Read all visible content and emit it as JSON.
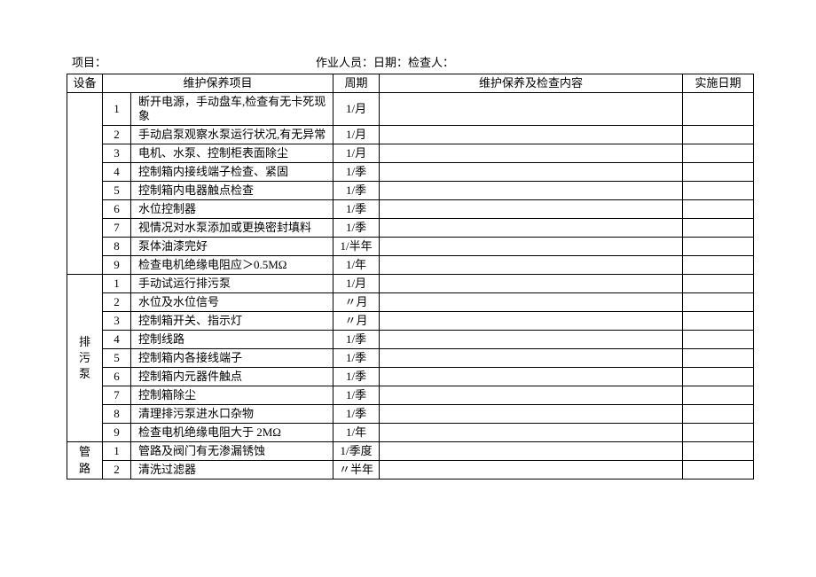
{
  "form_header": {
    "project": "项目：",
    "operator": "作业人员：",
    "date": "日期：",
    "inspector": "检查人："
  },
  "headers": {
    "equipment": "设备",
    "item": "维护保养项目",
    "cycle": "周期",
    "content": "维护保养及检查内容",
    "exec_date": "实施日期"
  },
  "group1": {
    "name": "",
    "rows": [
      {
        "no": "1",
        "item": "断开电源，手动盘车,检查有无卡死现象",
        "cycle": "1/月",
        "content": "",
        "date": ""
      },
      {
        "no": "2",
        "item": "手动启泵观察水泵运行状况,有无异常",
        "cycle": "1/月",
        "content": "",
        "date": ""
      },
      {
        "no": "3",
        "item": "电机、水泵、控制柜表面除尘",
        "cycle": "1/月",
        "content": "",
        "date": ""
      },
      {
        "no": "4",
        "item": "控制箱内接线端子检查、紧固",
        "cycle": "1/季",
        "content": "",
        "date": ""
      },
      {
        "no": "5",
        "item": "控制箱内电器触点检查",
        "cycle": "1/季",
        "content": "",
        "date": ""
      },
      {
        "no": "6",
        "item": "水位控制器",
        "cycle": "1/季",
        "content": "",
        "date": ""
      },
      {
        "no": "7",
        "item": "视情况对水泵添加或更换密封填料",
        "cycle": "1/季",
        "content": "",
        "date": ""
      },
      {
        "no": "8",
        "item": "泵体油漆完好",
        "cycle": "1/半年",
        "content": "",
        "date": ""
      },
      {
        "no": "9",
        "item": "检查电机绝缘电阻应＞0.5MΩ",
        "cycle": "1/年",
        "content": "",
        "date": ""
      }
    ]
  },
  "group2": {
    "name": "排污泵",
    "rows": [
      {
        "no": "1",
        "item": "手动试运行排污泵",
        "cycle": "1/月",
        "content": "",
        "date": ""
      },
      {
        "no": "2",
        "item": "水位及水位信号",
        "cycle": "〃月",
        "content": "",
        "date": ""
      },
      {
        "no": "3",
        "item": "控制箱开关、指示灯",
        "cycle": "〃月",
        "content": "",
        "date": ""
      },
      {
        "no": "4",
        "item": "控制线路",
        "cycle": "1/季",
        "content": "",
        "date": ""
      },
      {
        "no": "5",
        "item": "控制箱内各接线端子",
        "cycle": "1/季",
        "content": "",
        "date": ""
      },
      {
        "no": "6",
        "item": "控制箱内元器件触点",
        "cycle": "1/季",
        "content": "",
        "date": ""
      },
      {
        "no": "7",
        "item": "控制箱除尘",
        "cycle": "1/季",
        "content": "",
        "date": ""
      },
      {
        "no": "8",
        "item": "清理排污泵进水口杂物",
        "cycle": "1/季",
        "content": "",
        "date": ""
      },
      {
        "no": "9",
        "item": "检查电机绝缘电阻大于 2MΩ",
        "cycle": "1/年",
        "content": "",
        "date": ""
      }
    ]
  },
  "group3": {
    "name": "管路",
    "rows": [
      {
        "no": "1",
        "item": "管路及阀门有无渗漏锈蚀",
        "cycle": "1/季度",
        "content": "",
        "date": ""
      },
      {
        "no": "2",
        "item": "清洗过滤器",
        "cycle": "〃半年",
        "content": "",
        "date": ""
      }
    ]
  }
}
